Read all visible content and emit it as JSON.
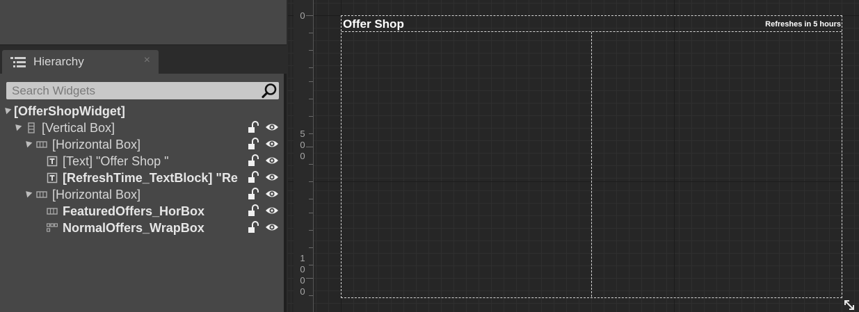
{
  "hierarchy": {
    "tab_label": "Hierarchy",
    "close_glyph": "×",
    "search_placeholder": "Search Widgets",
    "tree": [
      {
        "label": "[OfferShopWidget]",
        "bold": true,
        "depth": 0,
        "expanded": true,
        "icon": "none-icon",
        "controls": false
      },
      {
        "label": "[Vertical Box]",
        "bold": false,
        "depth": 1,
        "expanded": true,
        "icon": "vertical-box-icon",
        "controls": true
      },
      {
        "label": "[Horizontal Box]",
        "bold": false,
        "depth": 2,
        "expanded": true,
        "icon": "horizontal-box-icon",
        "controls": true
      },
      {
        "label": "[Text] \"Offer Shop \"",
        "bold": false,
        "depth": 3,
        "expanded": false,
        "icon": "text-icon",
        "controls": true
      },
      {
        "label": "[RefreshTime_TextBlock] \"Re",
        "bold": true,
        "depth": 3,
        "expanded": false,
        "icon": "text-icon",
        "controls": true
      },
      {
        "label": "[Horizontal Box]",
        "bold": false,
        "depth": 2,
        "expanded": true,
        "icon": "horizontal-box-icon",
        "controls": true
      },
      {
        "label": "FeaturedOffers_HorBox",
        "bold": true,
        "depth": 3,
        "expanded": false,
        "icon": "horizontal-box-icon",
        "controls": true
      },
      {
        "label": "NormalOffers_WrapBox",
        "bold": true,
        "depth": 3,
        "expanded": false,
        "icon": "wrap-box-icon",
        "controls": true
      }
    ]
  },
  "designer": {
    "ruler_labels": [
      {
        "digits": [
          "0"
        ]
      },
      {
        "digits": [
          "5",
          "0",
          "0"
        ]
      },
      {
        "digits": [
          "1",
          "0",
          "0",
          "0"
        ]
      }
    ],
    "shop_title": "Offer Shop",
    "refresh_text": "Refreshes in 5 hours"
  },
  "colors": {
    "panel": "#474747",
    "canvas": "#262626",
    "text": "#d6d6d6",
    "frame": "#d8d8d8"
  }
}
